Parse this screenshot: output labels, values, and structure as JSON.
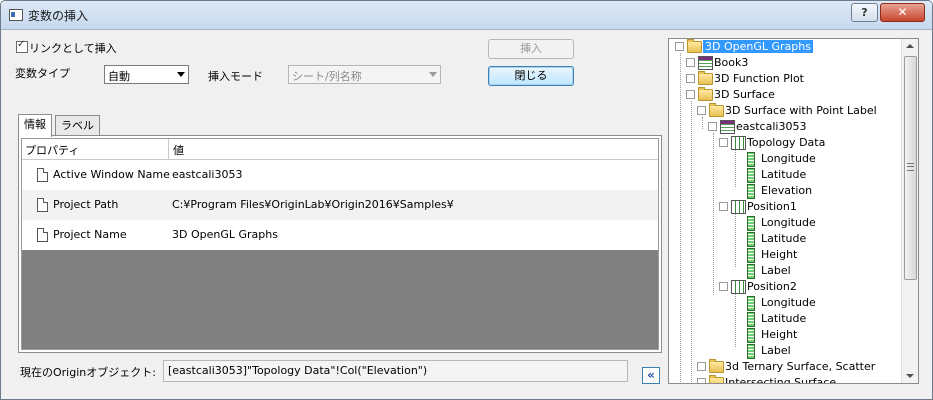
{
  "window": {
    "title": "変数の挿入",
    "help_label": "?",
    "close_label": "✕"
  },
  "options": {
    "link_checkbox_label": "リンクとして挿入",
    "link_checked": true,
    "var_type_label": "変数タイプ",
    "var_type_value": "自動",
    "insert_mode_label": "挿入モード",
    "insert_mode_value": "シート/列名称"
  },
  "buttons": {
    "insert_label": "挿入",
    "close_label": "閉じる",
    "collapse_label": "«"
  },
  "tabs": [
    {
      "label": "情報",
      "active": true
    },
    {
      "label": "ラベル",
      "active": false
    }
  ],
  "properties": {
    "headers": [
      "プロパティ",
      "値"
    ],
    "rows": [
      {
        "key": "Active Window Name",
        "value": "eastcali3053"
      },
      {
        "key": "Project Path",
        "value": "C:¥Program Files¥OriginLab¥Origin2016¥Samples¥"
      },
      {
        "key": "Project Name",
        "value": "3D OpenGL Graphs"
      }
    ]
  },
  "current_object": {
    "label": "現在のOriginオブジェクト:",
    "value": "[eastcali3053]\"Topology Data\"!Col(\"Elevation\")"
  },
  "tree": {
    "nodes": [
      {
        "label": "3D OpenGL Graphs",
        "icon": "folder-icon",
        "selected": true
      },
      {
        "label": "Book3",
        "icon": "workbook-icon"
      },
      {
        "label": "3D Function Plot",
        "icon": "folder-icon"
      },
      {
        "label": "3D Surface",
        "icon": "folder-icon"
      },
      {
        "label": "3D Surface with Point Label",
        "icon": "folder-icon"
      },
      {
        "label": "eastcali3053",
        "icon": "workbook-icon"
      },
      {
        "label": "Topology Data",
        "icon": "worksheet-icon"
      },
      {
        "label": "Longitude",
        "icon": "column-icon"
      },
      {
        "label": "Latitude",
        "icon": "column-icon"
      },
      {
        "label": "Elevation",
        "icon": "column-icon"
      },
      {
        "label": "Position1",
        "icon": "worksheet-icon"
      },
      {
        "label": "Longitude",
        "icon": "column-icon"
      },
      {
        "label": "Latitude",
        "icon": "column-icon"
      },
      {
        "label": "Height",
        "icon": "column-icon"
      },
      {
        "label": "Label",
        "icon": "column-icon"
      },
      {
        "label": "Position2",
        "icon": "worksheet-icon"
      },
      {
        "label": "Longitude",
        "icon": "column-icon"
      },
      {
        "label": "Latitude",
        "icon": "column-icon"
      },
      {
        "label": "Height",
        "icon": "column-icon"
      },
      {
        "label": "Label",
        "icon": "column-icon"
      },
      {
        "label": "3d Ternary Surface, Scatter",
        "icon": "folder-icon"
      },
      {
        "label": "Intersecting Surface",
        "icon": "folder-icon"
      }
    ]
  }
}
